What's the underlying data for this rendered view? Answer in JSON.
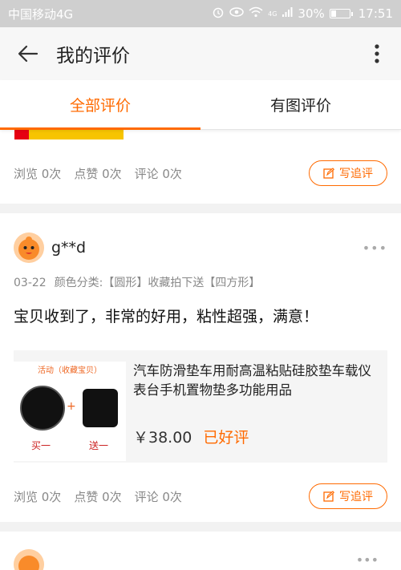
{
  "statusbar": {
    "carrier": "中国移动4G",
    "network": "4G",
    "battery": "30%",
    "battery_level": 0.3,
    "time": "17:51"
  },
  "appbar": {
    "title": "我的评价"
  },
  "tabs": [
    {
      "label": "全部评价",
      "active": true
    },
    {
      "label": "有图评价",
      "active": false
    }
  ],
  "reviews": [
    {
      "stats": {
        "views": "浏览 0次",
        "likes": "点赞 0次",
        "comments": "评论 0次"
      },
      "followup_label": "写追评"
    },
    {
      "username": "g**d",
      "date": "03-22",
      "spec": "颜色分类:【圆形】收藏拍下送【四方形】",
      "comment": "宝贝收到了，非常的好用，粘性超强，满意！",
      "product": {
        "image_texts": {
          "promo": "活动（收藏宝贝）",
          "buy": "买一",
          "gift": "送一"
        },
        "title": "汽车防滑垫车用耐高温粘贴硅胶垫车载仪表台手机置物垫多功能用品",
        "price": "￥38.00",
        "rating_label": "已好评"
      },
      "stats": {
        "views": "浏览 0次",
        "likes": "点赞 0次",
        "comments": "评论 0次"
      },
      "followup_label": "写追评"
    }
  ],
  "colors": {
    "accent": "#ff6a00",
    "statusbar": "#cfcfcf"
  }
}
